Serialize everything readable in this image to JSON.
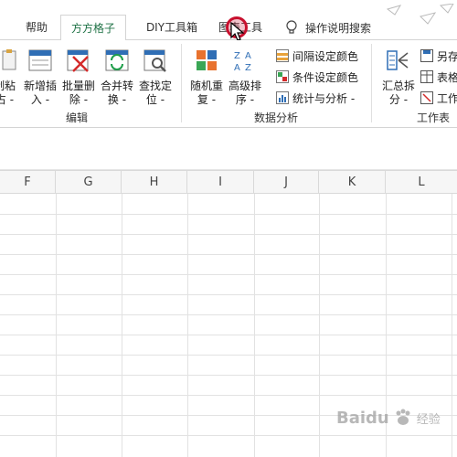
{
  "tabs": {
    "help": "帮助",
    "fangfang": "方方格子",
    "diy": "DIY工具箱",
    "chart": "图表工具",
    "tell_me": "操作说明搜索"
  },
  "ribbon": {
    "edit_group": {
      "label": "编辑",
      "paste": {
        "line1": "制粘",
        "line2": "占 -"
      },
      "insert": {
        "line1": "新增插",
        "line2": "入 -"
      },
      "batch_delete": {
        "line1": "批量删",
        "line2": "除 -"
      },
      "merge_convert": {
        "line1": "合并转",
        "line2": "换 -"
      },
      "find_locate": {
        "line1": "查找定",
        "line2": "位 -"
      }
    },
    "data_group": {
      "label": "数据分析",
      "random_dup": {
        "line1": "随机重",
        "line2": "复 -"
      },
      "advanced_sort": {
        "line1": "高级排",
        "line2": "序 -"
      },
      "interval_color": "间隔设定颜色",
      "condition_color": "条件设定颜色",
      "stats_analysis": "统计与分析 -"
    },
    "sheet_group": {
      "label": "工作表",
      "summary_split": {
        "line1": "汇总拆",
        "line2": "分 -"
      },
      "save_as": "另存",
      "table": "表格",
      "worksheet": "工作"
    }
  },
  "grid": {
    "columns": [
      "F",
      "G",
      "H",
      "I",
      "J",
      "K",
      "L"
    ]
  },
  "watermark": {
    "text": "Baidu",
    "suffix": "经验"
  },
  "colors": {
    "accent": "#1e7145",
    "cursor_ring": "#c8102e",
    "grid_line": "#e2e2e2",
    "header_bg": "#f6f6f6"
  }
}
